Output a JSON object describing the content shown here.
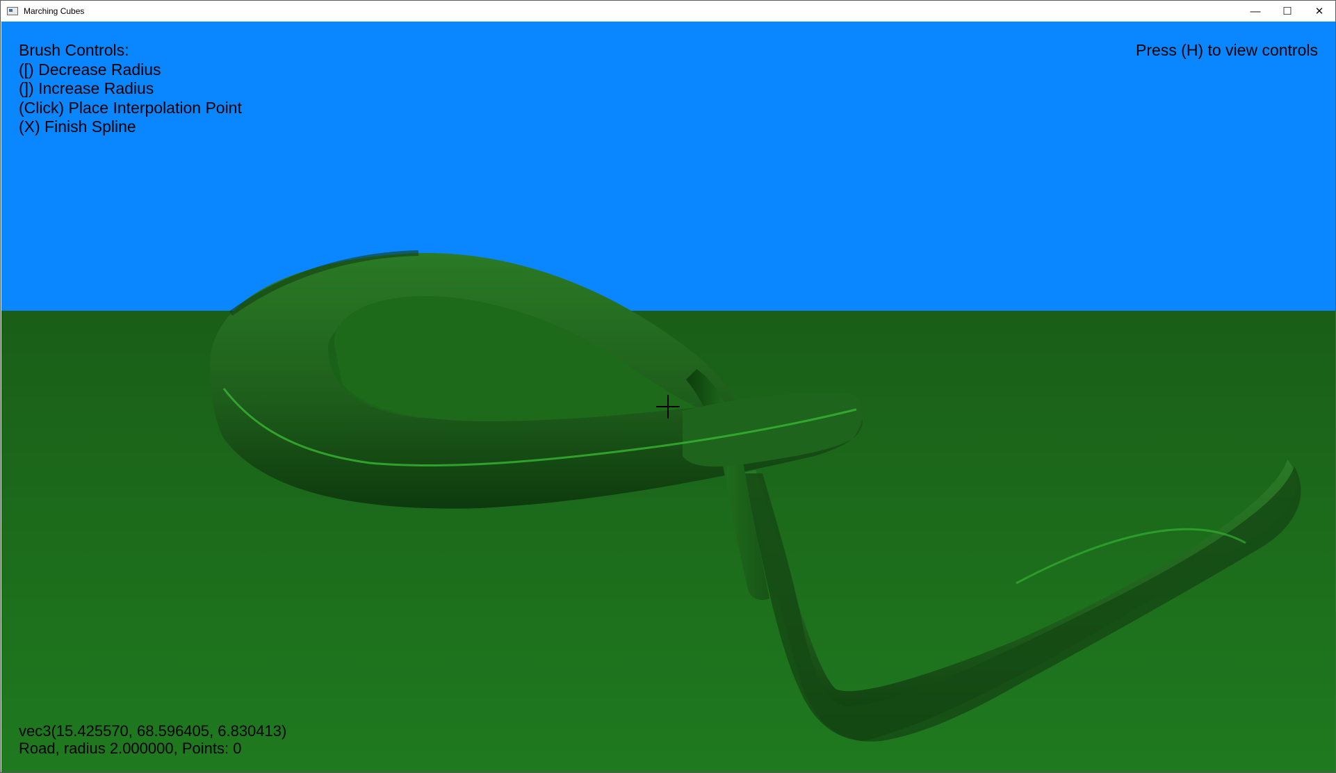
{
  "window": {
    "title": "Marching Cubes",
    "controls": {
      "minimize": "—",
      "maximize": "☐",
      "close": "✕"
    }
  },
  "hud": {
    "brush_controls": [
      "Brush Controls:",
      "([) Decrease Radius",
      "(]) Increase Radius",
      "(Click) Place Interpolation Point",
      "(X) Finish Spline"
    ],
    "help_hint": "Press (H) to view controls",
    "position_readout": "vec3(15.425570, 68.596405, 6.830413)",
    "status_readout": "Road, radius 2.000000, Points: 0"
  },
  "scene": {
    "sky_color": "#0a86ff",
    "ground_color": "#1b6a1b",
    "tube_color": "#1f5e1c"
  },
  "icons": {
    "app_icon": "window-app-icon",
    "crosshair": "crosshair-icon"
  }
}
